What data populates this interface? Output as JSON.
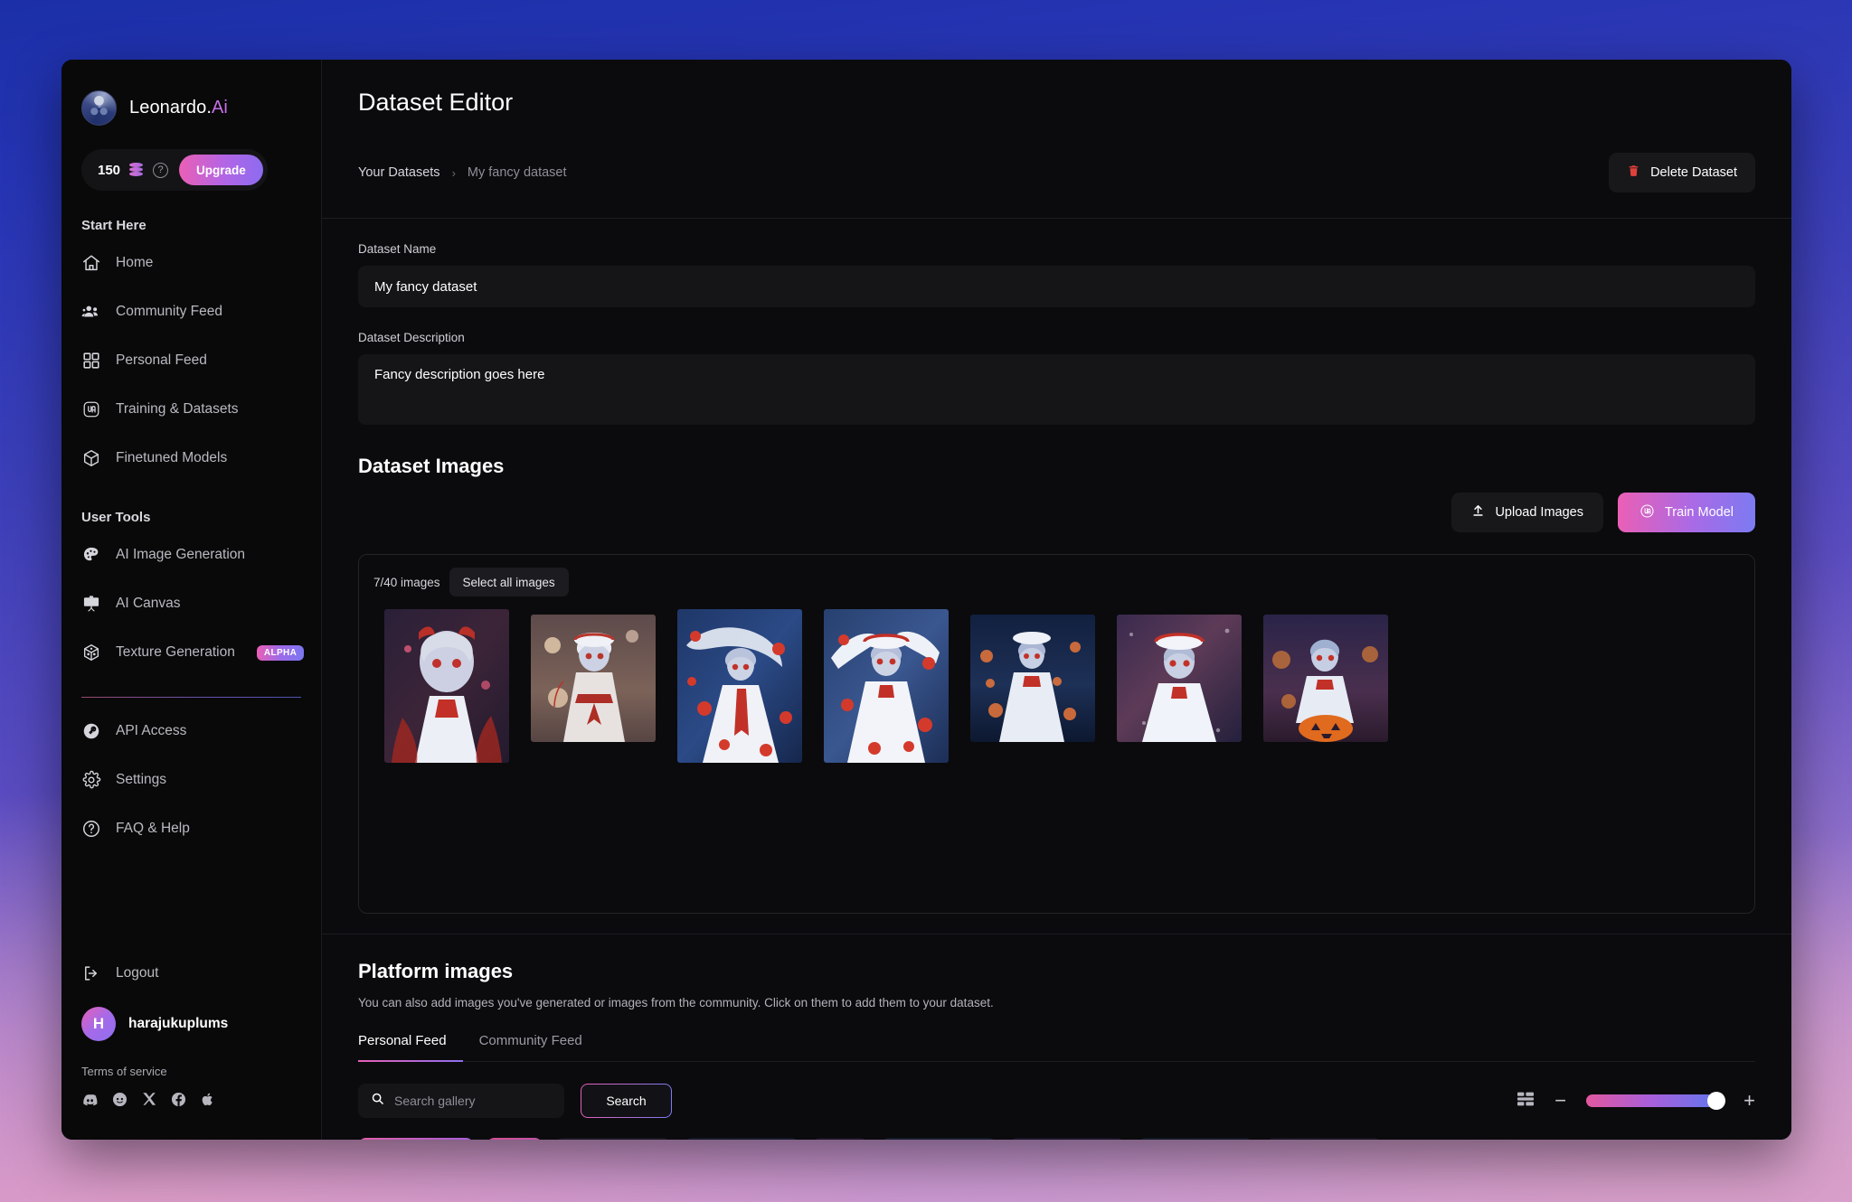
{
  "brand": {
    "name": "Leonardo.",
    "suffix": "Ai"
  },
  "credits": {
    "amount": "150",
    "upgrade_label": "Upgrade",
    "coin_icon": "coin-stack-icon",
    "help_icon": "help-circle-icon"
  },
  "sidebar": {
    "start_here_heading": "Start Here",
    "start_items": [
      {
        "label": "Home",
        "icon": "home-icon"
      },
      {
        "label": "Community Feed",
        "icon": "people-icon"
      },
      {
        "label": "Personal Feed",
        "icon": "grid-icon"
      },
      {
        "label": "Training & Datasets",
        "icon": "training-icon"
      },
      {
        "label": "Finetuned Models",
        "icon": "cube-icon"
      }
    ],
    "user_tools_heading": "User Tools",
    "tool_items": [
      {
        "label": "AI Image Generation",
        "icon": "palette-icon",
        "badge": ""
      },
      {
        "label": "AI Canvas",
        "icon": "easel-icon",
        "badge": ""
      },
      {
        "label": "Texture Generation",
        "icon": "texture-cube-icon",
        "badge": "ALPHA"
      }
    ],
    "utility_items": [
      {
        "label": "API Access",
        "icon": "key-icon"
      },
      {
        "label": "Settings",
        "icon": "gear-icon"
      },
      {
        "label": "FAQ & Help",
        "icon": "question-circle-icon"
      }
    ],
    "logout_label": "Logout",
    "logout_icon": "logout-icon",
    "user": {
      "initial": "H",
      "name": "harajukuplums"
    },
    "terms_label": "Terms of service",
    "socials": [
      "discord-icon",
      "reddit-icon",
      "x-icon",
      "facebook-icon",
      "apple-icon"
    ]
  },
  "header": {
    "title": "Dataset Editor",
    "breadcrumb_root": "Your Datasets",
    "breadcrumb_sep": "›",
    "breadcrumb_current": "My fancy dataset",
    "delete_label": "Delete Dataset",
    "delete_icon": "trash-icon"
  },
  "form": {
    "name_label": "Dataset Name",
    "name_value": "My fancy dataset",
    "name_placeholder": "Dataset Name",
    "description_label": "Dataset Description",
    "description_value": "Fancy description goes here",
    "description_placeholder": "Dataset Description"
  },
  "dataset_images": {
    "title": "Dataset Images",
    "upload_label": "Upload Images",
    "upload_icon": "upload-icon",
    "train_label": "Train Model",
    "train_icon": "leonardo-mark-icon",
    "count_text": "7/40 images",
    "select_all_label": "Select all images",
    "thumbnails": [
      {
        "alt": "anime girl red ribbon hat portrait"
      },
      {
        "alt": "anime girl with lanterns white dress"
      },
      {
        "alt": "anime girl white parasol red petals"
      },
      {
        "alt": "anime girl angel wings red petals"
      },
      {
        "alt": "anime girl night lanterns blue"
      },
      {
        "alt": "anime girl white hat starry night"
      },
      {
        "alt": "anime girl pumpkin halloween"
      }
    ]
  },
  "platform": {
    "title": "Platform images",
    "description": "You can also add images you've generated or images from the community. Click on them to add them to your dataset.",
    "tabs": [
      {
        "label": "Personal Feed",
        "active": true
      },
      {
        "label": "Community Feed",
        "active": false
      }
    ],
    "search_placeholder": "Search gallery",
    "search_value": "",
    "search_button_label": "Search",
    "search_icon": "search-icon",
    "layout_icon": "layout-grid-icon",
    "zoom_out_label": "−",
    "zoom_in_label": "+",
    "zoom_icon_out": "minus-icon",
    "zoom_icon_in": "plus-icon",
    "zoom_value": "100"
  },
  "colors": {
    "accent_pink": "#ec5fb4",
    "accent_purple": "#a96ae6",
    "accent_blue": "#7b7bf2",
    "danger_red": "#e0413a",
    "panel_bg": "#0b0b0d",
    "sidebar_bg": "#090909",
    "input_bg": "#151518"
  }
}
